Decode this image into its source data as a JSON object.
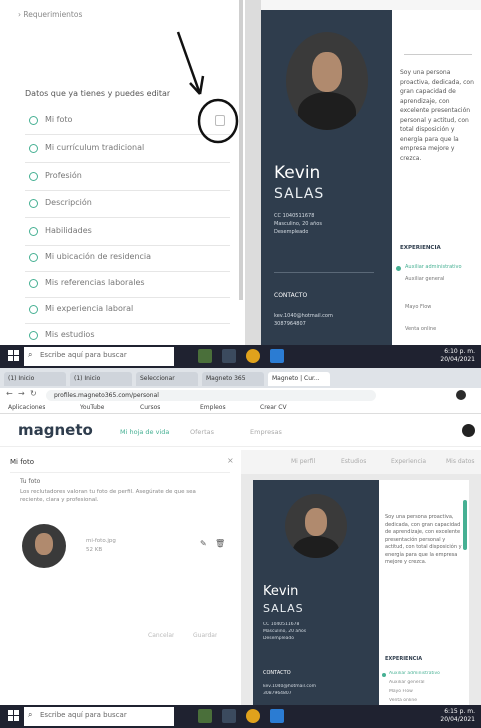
{
  "top": {
    "requirements_label": "Requerimientos",
    "section_title": "Datos que ya tienes y puedes editar",
    "items": [
      {
        "label": "Mi foto"
      },
      {
        "label": "Mi currículum tradicional"
      },
      {
        "label": "Profesión"
      },
      {
        "label": "Descripción"
      },
      {
        "label": "Habilidades"
      },
      {
        "label": "Mi ubicación de residencia"
      },
      {
        "label": "Mis referencias laborales"
      },
      {
        "label": "Mi experiencia laboral"
      },
      {
        "label": "Mis estudios"
      }
    ],
    "cv": {
      "first_name": "Kevin",
      "last_name": "SALAS",
      "id_line": "CC 1040511678",
      "gender_age": "Masculino, 20 años",
      "status": "Desempleado",
      "contact_heading": "CONTACTO",
      "email": "kev.1040@hotmail.com",
      "phone": "3087964807",
      "summary": "Soy una persona proactiva, dedicada, con gran capacidad de aprendizaje, con excelente presentación personal y actitud, con total disposición y energía para que la empresa mejore y crezca.",
      "experience_heading": "EXPERIENCIA",
      "experience": [
        "Auxiliar administrativo",
        "Auxiliar general",
        "Mayo Flow",
        "Venta online"
      ]
    },
    "taskbar": {
      "search_placeholder": "Escribe aquí para buscar",
      "time": "6:10 p. m.",
      "date": "20/04/2021"
    }
  },
  "bottom": {
    "tabs": [
      "(1) Inicio",
      "(1) Inicio",
      "Seleccionar",
      "Magneto 365",
      "Magneto | Cur..."
    ],
    "url": "profiles.magneto365.com/personal",
    "bookmarks": [
      "Aplicaciones",
      "YouTube",
      "Cursos",
      "Empleos",
      "Crear CV"
    ],
    "logo": "magneto",
    "nav": [
      "Mi hoja de vida",
      "Ofertas",
      "Empresas"
    ],
    "card": {
      "title": "Mi foto",
      "subtitle": "Tu foto",
      "text": "Los reclutadores valoran tu foto de perfil. Asegúrate de que sea reciente, clara y profesional.",
      "file_name": "mi-foto.jpg",
      "file_size": "52 KB",
      "cancel": "Cancelar",
      "save": "Guardar"
    },
    "preview_tabs": [
      "Mi perfil",
      "Estudios",
      "Experiencia",
      "Mis datos"
    ],
    "cv": {
      "first_name": "Kevin",
      "last_name": "SALAS",
      "id_line": "CC 1040511678",
      "gender_age": "Masculino, 20 años",
      "status": "Desempleado",
      "contact_heading": "CONTACTO",
      "email": "kev.1040@hotmail.com",
      "phone": "3087964807",
      "summary": "Soy una persona proactiva, dedicada, con gran capacidad de aprendizaje, con excelente presentación personal y actitud, con total disposición y energía para que la empresa mejore y crezca.",
      "experience_heading": "EXPERIENCIA",
      "experience": [
        "Auxiliar administrativo",
        "Auxiliar general",
        "Mayo Flow",
        "Venta online"
      ]
    },
    "taskbar": {
      "search_placeholder": "Escribe aquí para buscar",
      "time": "6:15 p. m.",
      "date": "20/04/2021"
    }
  },
  "colors": {
    "accent": "#46b093",
    "sidebar": "#2f3d4d",
    "taskbar": "#1f2230"
  }
}
